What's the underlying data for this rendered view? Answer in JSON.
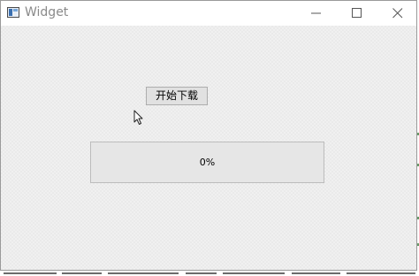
{
  "window": {
    "title": "Widget",
    "app_icon": "app-window-icon",
    "controls": {
      "minimize_icon": "minimize-icon",
      "maximize_icon": "maximize-icon",
      "close_icon": "close-icon"
    }
  },
  "main": {
    "start_button_label": "开始下载",
    "progress": {
      "value": 0,
      "text": "0%"
    }
  },
  "colors": {
    "window_bg": "#f0f0f0",
    "button_bg": "#e1e1e1",
    "progress_fill": "#06b025"
  }
}
